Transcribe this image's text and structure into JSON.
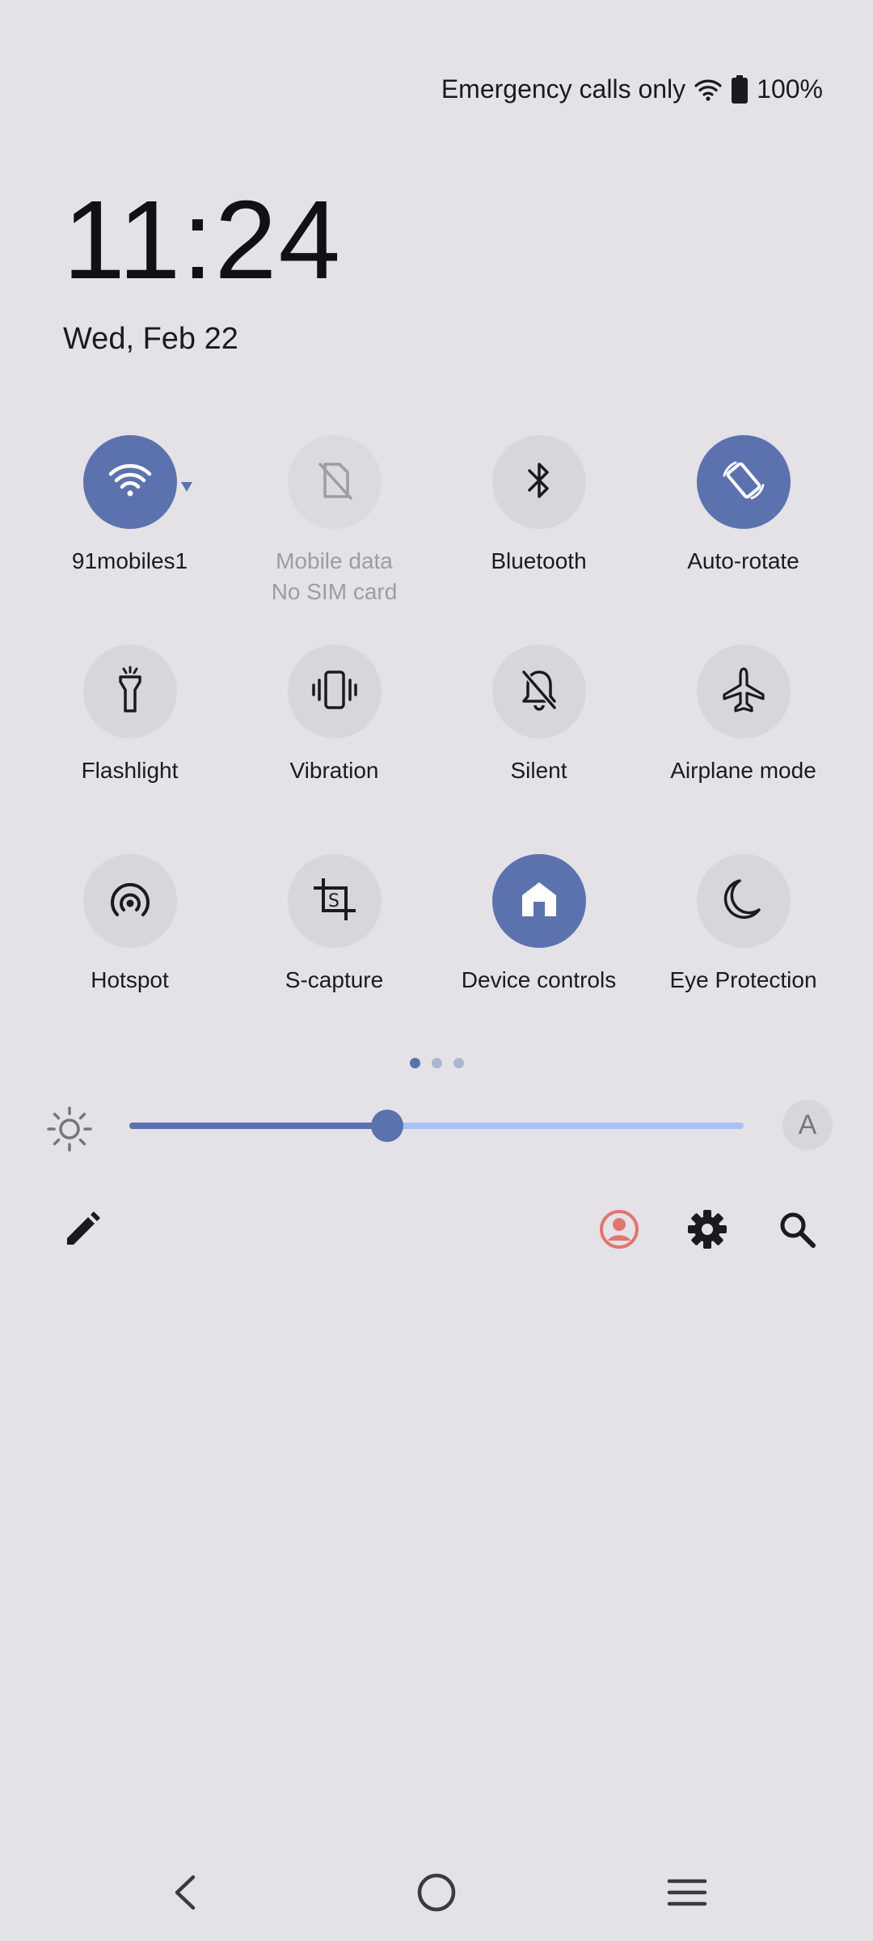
{
  "status_bar": {
    "carrier_text": "Emergency calls only",
    "battery": "100%",
    "icons": [
      "wifi-icon",
      "battery-icon"
    ]
  },
  "clock": {
    "time": "11:24",
    "date": "Wed, Feb 22"
  },
  "tiles": [
    {
      "label": "91mobiles1",
      "sublabel": "",
      "icon": "wifi-icon",
      "state": "active"
    },
    {
      "label": "Mobile data",
      "sublabel": "No SIM card",
      "icon": "no-sim-icon",
      "state": "disabled"
    },
    {
      "label": "Bluetooth",
      "sublabel": "",
      "icon": "bluetooth-icon",
      "state": "off"
    },
    {
      "label": "Auto-rotate",
      "sublabel": "",
      "icon": "rotate-icon",
      "state": "active"
    },
    {
      "label": "Flashlight",
      "sublabel": "",
      "icon": "flashlight-icon",
      "state": "off"
    },
    {
      "label": "Vibration",
      "sublabel": "",
      "icon": "vibration-icon",
      "state": "off"
    },
    {
      "label": "Silent",
      "sublabel": "",
      "icon": "bell-off-icon",
      "state": "off"
    },
    {
      "label": "Airplane mode",
      "sublabel": "",
      "icon": "airplane-icon",
      "state": "off"
    },
    {
      "label": "Hotspot",
      "sublabel": "",
      "icon": "hotspot-icon",
      "state": "off"
    },
    {
      "label": "S-capture",
      "sublabel": "",
      "icon": "screenshot-icon",
      "state": "off"
    },
    {
      "label": "Device controls",
      "sublabel": "",
      "icon": "home-icon",
      "state": "active"
    },
    {
      "label": "Eye Protection",
      "sublabel": "",
      "icon": "moon-icon",
      "state": "off"
    }
  ],
  "pager": {
    "pages": 3,
    "current": 1
  },
  "brightness": {
    "level": 0.42,
    "auto_label": "A"
  },
  "actions": [
    "edit-icon",
    "user-icon",
    "settings-icon",
    "search-icon"
  ],
  "colors": {
    "accent": "#5b72ae",
    "background": "#e4e2e7",
    "tile_off": "#d8d6dc",
    "user_icon": "#e0766e",
    "track_light": "#aac0f5"
  },
  "nav": [
    "back-icon",
    "home-circle-icon",
    "menu-icon"
  ]
}
